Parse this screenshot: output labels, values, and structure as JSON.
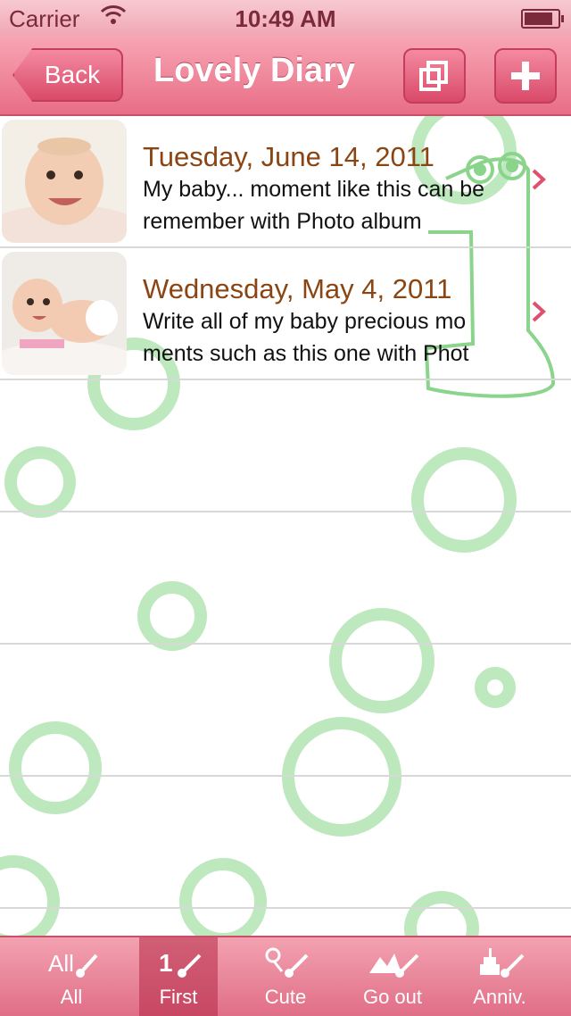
{
  "status_bar": {
    "carrier": "Carrier",
    "time": "10:49 AM",
    "battery_level": 0.85
  },
  "nav": {
    "back_label": "Back",
    "title": "Lovely Diary"
  },
  "entries": [
    {
      "date": "Tuesday, June 14, 2011",
      "text": "My baby...  moment like this can be remember with Photo album"
    },
    {
      "date": "Wednesday, May 4, 2011",
      "text": "Write all of my baby precious mo ments such as this one with Phot"
    }
  ],
  "tabs": [
    {
      "label": "All",
      "icon": "all-icon"
    },
    {
      "label": "First",
      "icon": "first-icon"
    },
    {
      "label": "Cute",
      "icon": "cute-icon"
    },
    {
      "label": "Go out",
      "icon": "go-out-icon"
    },
    {
      "label": "Anniv.",
      "icon": "anniversary-icon"
    }
  ],
  "colors": {
    "accent": "#e86d86",
    "date": "#8b4513",
    "deco_green": "#a8e0a8"
  }
}
